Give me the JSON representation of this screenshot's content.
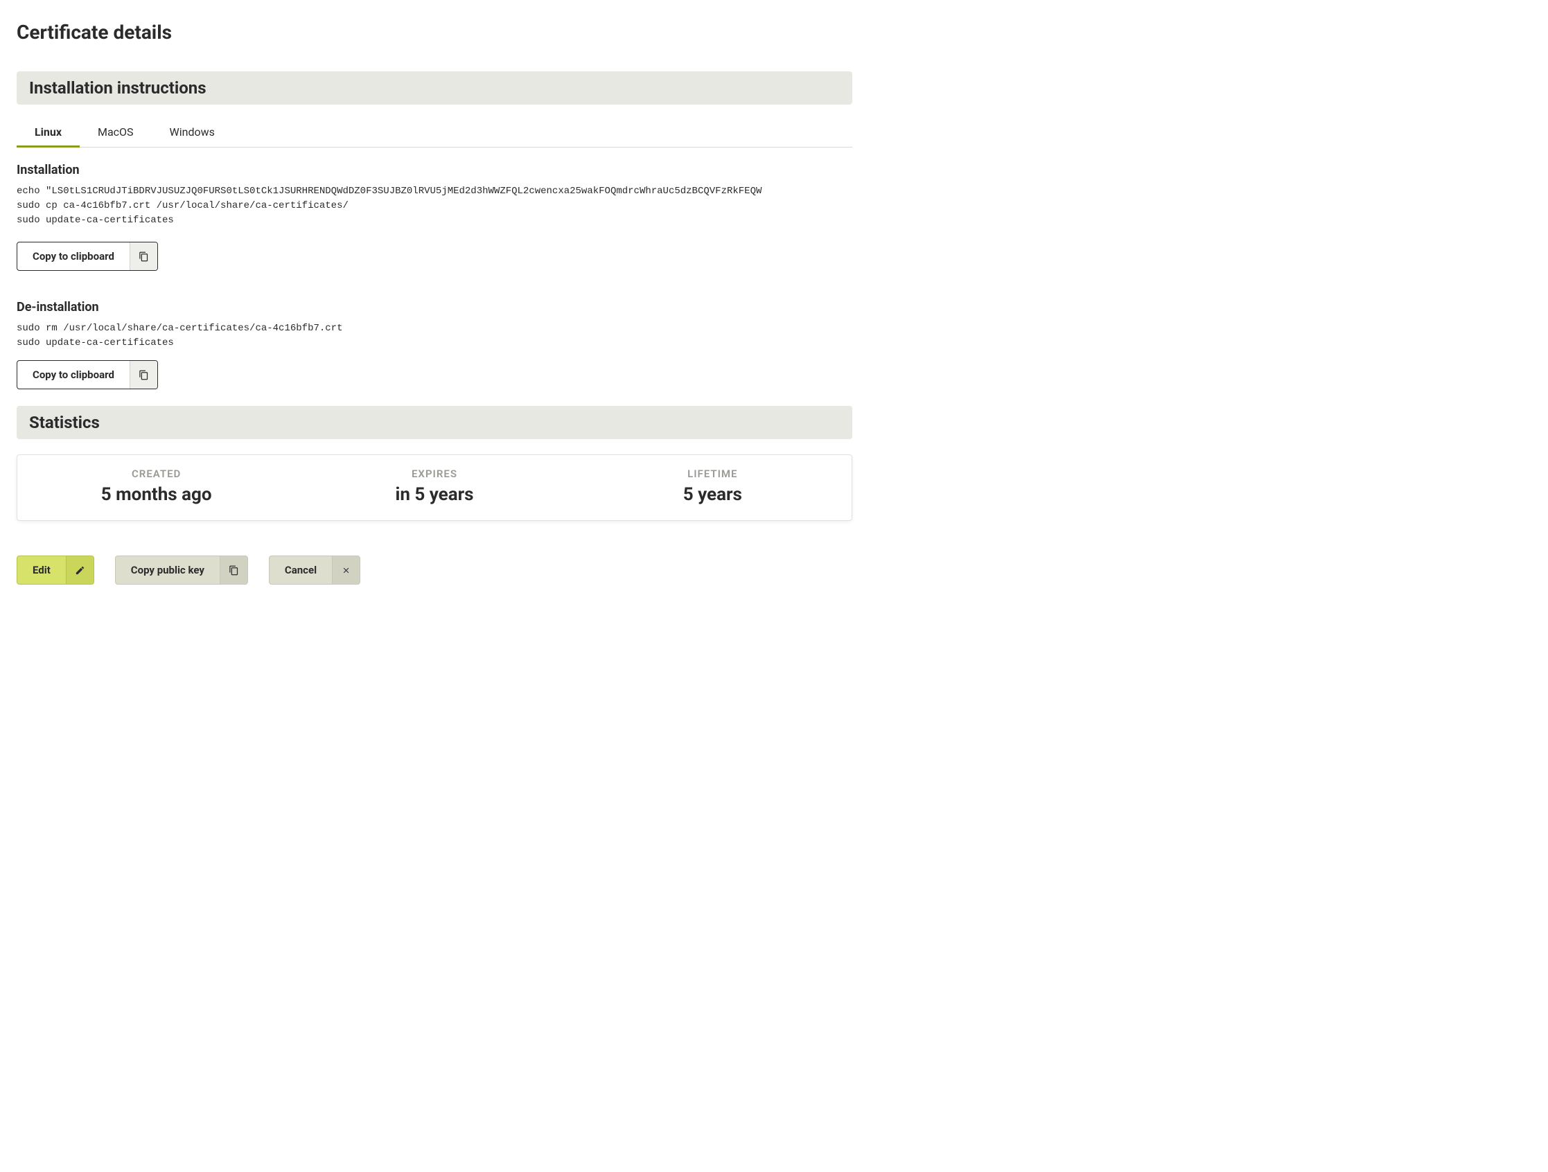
{
  "page_title": "Certificate details",
  "install_panel": {
    "header": "Installation instructions",
    "tabs": [
      "Linux",
      "MacOS",
      "Windows"
    ],
    "active_tab": "Linux",
    "install_heading": "Installation",
    "install_code": "echo \"LS0tLS1CRUdJTiBDRVJUSUZJQ0FURS0tLS0tCk1JSURHRENDQWdDZ0F3SUJBZ0lRVU5jMEd2d3hWWZFQL2cwencxa25wakFOQmdrcWhraUc5dzBCQVFzRkFEQW\nsudo cp ca-4c16bfb7.crt /usr/local/share/ca-certificates/\nsudo update-ca-certificates",
    "deinstall_heading": "De-installation",
    "deinstall_code": "sudo rm /usr/local/share/ca-certificates/ca-4c16bfb7.crt\nsudo update-ca-certificates",
    "copy_label": "Copy to clipboard"
  },
  "stats_panel": {
    "header": "Statistics",
    "items": [
      {
        "label": "CREATED",
        "value": "5 months ago"
      },
      {
        "label": "EXPIRES",
        "value": "in 5 years"
      },
      {
        "label": "LIFETIME",
        "value": "5 years"
      }
    ]
  },
  "actions": {
    "edit": "Edit",
    "copy_pubkey": "Copy public key",
    "cancel": "Cancel"
  }
}
